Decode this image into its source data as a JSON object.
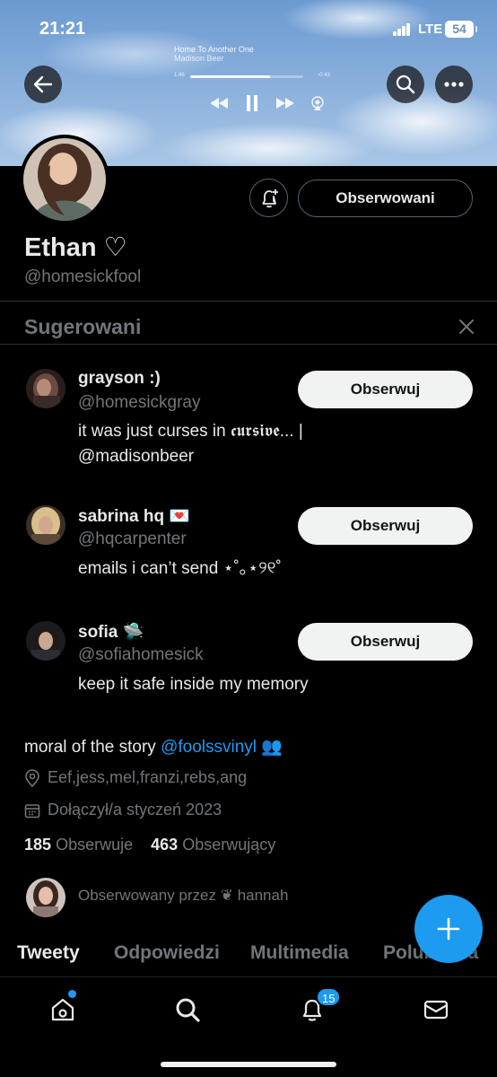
{
  "status": {
    "time": "21:21",
    "network": "LTE",
    "battery": "54"
  },
  "now_playing": {
    "title": "Home To Another One",
    "artist": "Madison Beer",
    "elapsed": "1:46",
    "remaining": "-0:43",
    "progress": 0.71
  },
  "profile": {
    "name": "Ethan ♡",
    "handle": "@homesickfool",
    "follow_state_label": "Obserwowani",
    "bio_text": "moral of the story ",
    "bio_link": "@foolssvinyl",
    "bio_emoji": "👥",
    "location": "Eef,jess,mel,franzi,rebs,ang",
    "joined": "Dołączył/a styczeń 2023",
    "following_count": "185",
    "following_label": "Obserwuje",
    "followers_count": "463",
    "followers_label": "Obserwujący",
    "followed_by": "Obserwowany przez ❦ hannah"
  },
  "suggestions": {
    "title": "Sugerowani",
    "items": [
      {
        "name": "grayson :)",
        "handle": "@homesickgray",
        "bio_line1": "it was just curses in 𝖈𝖚𝖗𝖘𝖎𝖛𝖊... |",
        "bio_line2": "@madisonbeer",
        "button": "Obserwuj"
      },
      {
        "name": "sabrina hq 💌",
        "handle": "@hqcarpenter",
        "bio_line1": "emails i can’t send ⋆˚｡⋆୨୧˚",
        "bio_line2": "",
        "button": "Obserwuj"
      },
      {
        "name": "sofia 🛸",
        "handle": "@sofiahomesick",
        "bio_line1": "keep it safe inside my memory",
        "bio_line2": "",
        "button": "Obserwuj"
      }
    ]
  },
  "tabs": [
    "Tweety",
    "Odpowiedzi",
    "Multimedia",
    "Polubienia"
  ],
  "nav": {
    "notifications_badge": "15"
  },
  "icons": [
    "back-arrow-icon",
    "search-icon",
    "more-icon",
    "bell-plus-icon",
    "close-icon",
    "location-icon",
    "calendar-icon",
    "plus-icon",
    "home-icon",
    "bell-icon",
    "mail-icon"
  ],
  "colors": {
    "accent": "#1d9bf0",
    "background": "#000000",
    "muted": "#71767b",
    "divider": "#2f3336"
  }
}
